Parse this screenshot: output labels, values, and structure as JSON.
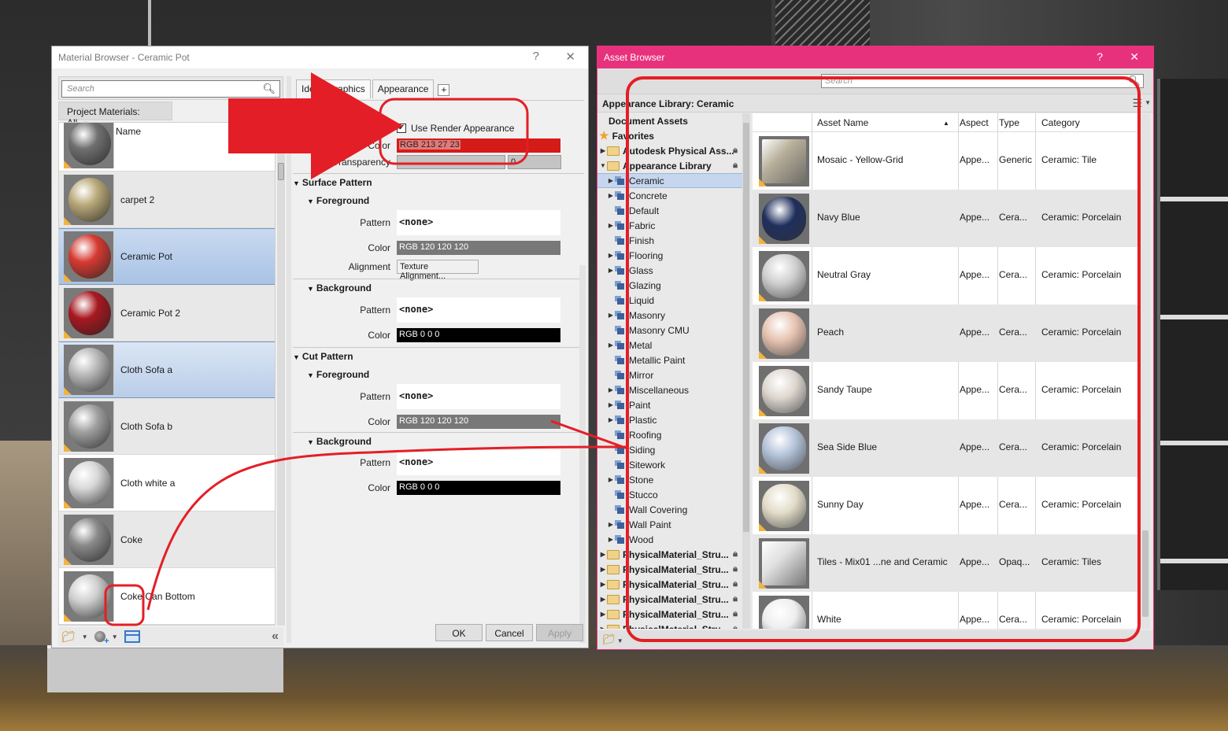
{
  "material_browser": {
    "title": "Material Browser - Ceramic Pot",
    "help_label": "?",
    "close_label": "✕",
    "search_placeholder": "Search",
    "filter_label": "Project Materials: All",
    "list_header": "Name",
    "materials": [
      {
        "name": "",
        "thumb": "#707070",
        "state": "normal"
      },
      {
        "name": "carpet 2",
        "thumb": "#b8a878",
        "state": "alt"
      },
      {
        "name": "Ceramic Pot",
        "thumb": "#d63a32",
        "state": "selected"
      },
      {
        "name": "Ceramic Pot 2",
        "thumb": "#a81820",
        "state": "alt"
      },
      {
        "name": "Cloth Sofa a",
        "thumb": "#b8b8b8",
        "state": "selected-light"
      },
      {
        "name": "Cloth Sofa b",
        "thumb": "#a0a0a0",
        "state": "alt"
      },
      {
        "name": "Cloth white a",
        "thumb": "#d8d8d8",
        "state": "normal"
      },
      {
        "name": "Coke",
        "thumb": "#8a8a8a",
        "state": "alt"
      },
      {
        "name": "Coke Can Bottom",
        "thumb": "#cfcfcf",
        "state": "normal"
      }
    ],
    "tabs": [
      {
        "label": "Identity",
        "visible": "Ide"
      },
      {
        "label": "Graphics"
      },
      {
        "label": "Appearance"
      }
    ],
    "add_tab_label": "+",
    "shading": {
      "use_render_appearance_label": "Use Render Appearance",
      "use_render_appearance_checked": true,
      "color_label": "Color",
      "color_value": "RGB 213 27 23",
      "color_hex": "#d51b17",
      "transparency_label": "Transparency",
      "transparency_value": "0"
    },
    "surface_pattern": {
      "title": "Surface Pattern",
      "foreground": {
        "title": "Foreground",
        "pattern_label": "Pattern",
        "pattern_value": "<none>",
        "color_label": "Color",
        "color_value": "RGB 120 120 120",
        "alignment_label": "Alignment",
        "alignment_button": "Texture Alignment..."
      },
      "background": {
        "title": "Background",
        "pattern_label": "Pattern",
        "pattern_value": "<none>",
        "color_label": "Color",
        "color_value": "RGB 0 0 0"
      }
    },
    "cut_pattern": {
      "title": "Cut Pattern",
      "foreground": {
        "title": "Foreground",
        "pattern_label": "Pattern",
        "pattern_value": "<none>",
        "color_label": "Color",
        "color_value": "RGB 120 120 120"
      },
      "background": {
        "title": "Background",
        "pattern_label": "Pattern",
        "pattern_value": "<none>",
        "color_label": "Color",
        "color_value": "RGB 0 0 0"
      }
    },
    "buttons": {
      "ok": "OK",
      "cancel": "Cancel",
      "apply": "Apply"
    }
  },
  "asset_browser": {
    "title": "Asset Browser",
    "help_label": "?",
    "close_label": "✕",
    "title_color": "#e8317c",
    "search_placeholder": "Search",
    "library_label": "Appearance Library: Ceramic",
    "tree": [
      {
        "label": "Document Assets",
        "kind": "header",
        "level": 0
      },
      {
        "label": "Favorites",
        "kind": "star",
        "level": 0
      },
      {
        "label": "Autodesk Physical Ass...",
        "kind": "folder",
        "level": 0,
        "expander": "▶",
        "locked": true
      },
      {
        "label": "Appearance Library",
        "kind": "folder",
        "level": 0,
        "expander": "▼",
        "locked": true
      },
      {
        "label": "Ceramic",
        "kind": "lib",
        "level": 1,
        "expander": "▶",
        "selected": true
      },
      {
        "label": "Concrete",
        "kind": "lib",
        "level": 1,
        "expander": "▶"
      },
      {
        "label": "Default",
        "kind": "lib",
        "level": 1
      },
      {
        "label": "Fabric",
        "kind": "lib",
        "level": 1,
        "expander": "▶"
      },
      {
        "label": "Finish",
        "kind": "lib",
        "level": 1
      },
      {
        "label": "Flooring",
        "kind": "lib",
        "level": 1,
        "expander": "▶"
      },
      {
        "label": "Glass",
        "kind": "lib",
        "level": 1,
        "expander": "▶"
      },
      {
        "label": "Glazing",
        "kind": "lib",
        "level": 1
      },
      {
        "label": "Liquid",
        "kind": "lib",
        "level": 1
      },
      {
        "label": "Masonry",
        "kind": "lib",
        "level": 1,
        "expander": "▶"
      },
      {
        "label": "Masonry CMU",
        "kind": "lib",
        "level": 1
      },
      {
        "label": "Metal",
        "kind": "lib",
        "level": 1,
        "expander": "▶"
      },
      {
        "label": "Metallic Paint",
        "kind": "lib",
        "level": 1
      },
      {
        "label": "Mirror",
        "kind": "lib",
        "level": 1
      },
      {
        "label": "Miscellaneous",
        "kind": "lib",
        "level": 1,
        "expander": "▶"
      },
      {
        "label": "Paint",
        "kind": "lib",
        "level": 1,
        "expander": "▶"
      },
      {
        "label": "Plastic",
        "kind": "lib",
        "level": 1,
        "expander": "▶"
      },
      {
        "label": "Roofing",
        "kind": "lib",
        "level": 1
      },
      {
        "label": "Siding",
        "kind": "lib",
        "level": 1
      },
      {
        "label": "Sitework",
        "kind": "lib",
        "level": 1
      },
      {
        "label": "Stone",
        "kind": "lib",
        "level": 1,
        "expander": "▶"
      },
      {
        "label": "Stucco",
        "kind": "lib",
        "level": 1
      },
      {
        "label": "Wall Covering",
        "kind": "lib",
        "level": 1
      },
      {
        "label": "Wall Paint",
        "kind": "lib",
        "level": 1,
        "expander": "▶"
      },
      {
        "label": "Wood",
        "kind": "lib",
        "level": 1,
        "expander": "▶"
      },
      {
        "label": "PhysicalMaterial_Stru...",
        "kind": "folder",
        "level": 0,
        "expander": "▶",
        "locked": true
      },
      {
        "label": "PhysicalMaterial_Stru...",
        "kind": "folder",
        "level": 0,
        "expander": "▶",
        "locked": true
      },
      {
        "label": "PhysicalMaterial_Stru...",
        "kind": "folder",
        "level": 0,
        "expander": "▶",
        "locked": true
      },
      {
        "label": "PhysicalMaterial_Stru...",
        "kind": "folder",
        "level": 0,
        "expander": "▶",
        "locked": true
      },
      {
        "label": "PhysicalMaterial_Stru...",
        "kind": "folder",
        "level": 0,
        "expander": "▶",
        "locked": true
      },
      {
        "label": "PhysicalMaterial_Stru...",
        "kind": "folder",
        "level": 0,
        "expander": "▶",
        "locked": true
      }
    ],
    "columns": {
      "name": "Asset Name",
      "sort_indicator": "▲",
      "aspect": "Aspect",
      "type": "Type",
      "category": "Category"
    },
    "assets": [
      {
        "name": "Mosaic - Yellow-Grid",
        "aspect": "Appe...",
        "type": "Generic",
        "category": "Ceramic: Tile",
        "swatch": "#b7ae9a",
        "shape": "cube"
      },
      {
        "name": "Navy Blue",
        "aspect": "Appe...",
        "type": "Cera...",
        "category": "Ceramic: Porcelain",
        "swatch": "#1f2f5c",
        "shape": "pot"
      },
      {
        "name": "Neutral Gray",
        "aspect": "Appe...",
        "type": "Cera...",
        "category": "Ceramic: Porcelain",
        "swatch": "#cfcfcf",
        "shape": "pot"
      },
      {
        "name": "Peach",
        "aspect": "Appe...",
        "type": "Cera...",
        "category": "Ceramic: Porcelain",
        "swatch": "#e6c2b0",
        "shape": "pot"
      },
      {
        "name": "Sandy Taupe",
        "aspect": "Appe...",
        "type": "Cera...",
        "category": "Ceramic: Porcelain",
        "swatch": "#ddd6cf",
        "shape": "pot"
      },
      {
        "name": "Sea Side Blue",
        "aspect": "Appe...",
        "type": "Cera...",
        "category": "Ceramic: Porcelain",
        "swatch": "#b3c2d8",
        "shape": "pot"
      },
      {
        "name": "Sunny Day",
        "aspect": "Appe...",
        "type": "Cera...",
        "category": "Ceramic: Porcelain",
        "swatch": "#e2dcc8",
        "shape": "pot"
      },
      {
        "name": "Tiles - Mix01 ...ne and Ceramic",
        "aspect": "Appe...",
        "type": "Opaq...",
        "category": "Ceramic: Tiles",
        "swatch": "#e0e0e0",
        "shape": "cube"
      },
      {
        "name": "White",
        "aspect": "Appe...",
        "type": "Cera...",
        "category": "Ceramic: Porcelain",
        "swatch": "#eeeeee",
        "shape": "pot"
      }
    ]
  },
  "annotation_color": "#e41e26"
}
